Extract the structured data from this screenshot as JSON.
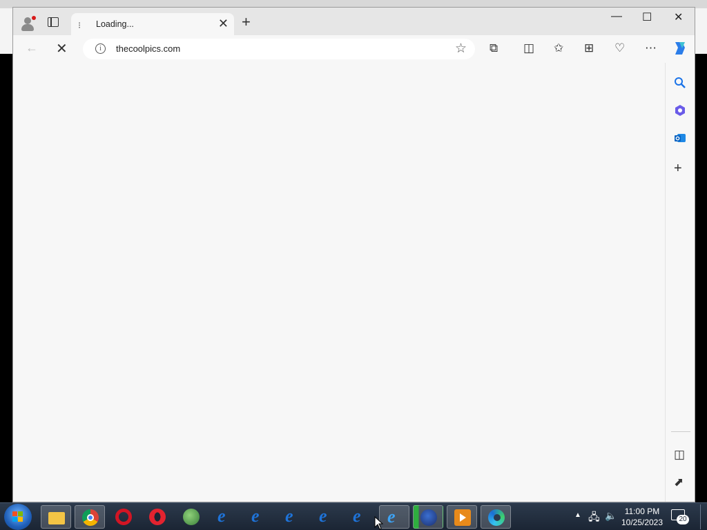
{
  "browser": {
    "tab": {
      "title": "Loading...",
      "close_glyph": "✕"
    },
    "new_tab_glyph": "+",
    "window_controls": {
      "minimize": "—",
      "maximize": "☐",
      "close": "✕"
    },
    "toolbar": {
      "back_glyph": "←",
      "stop_glyph": "✕",
      "info_glyph": "i",
      "star_glyph": "☆",
      "more_glyph": "⋯"
    },
    "address": {
      "url": "thecoolpics.com"
    },
    "toolbar_icons": [
      "extensions-icon",
      "split-screen-icon",
      "favorites-icon",
      "collections-icon",
      "browser-essentials-icon",
      "more-icon",
      "copilot-icon"
    ],
    "sidebar_icons": [
      "search-icon",
      "office-icon",
      "outlook-icon",
      "add-icon",
      "hide-sidebar-icon",
      "external-link-icon",
      "settings-icon"
    ],
    "sidebar_add_glyph": "+"
  },
  "taskbar": {
    "apps": [
      "file-explorer-icon",
      "chrome-icon",
      "opera-icon",
      "opera-icon",
      "network-globe-icon",
      "internet-explorer-icon",
      "internet-explorer-icon",
      "internet-explorer-icon",
      "internet-explorer-icon",
      "internet-explorer-icon",
      "internet-explorer-icon",
      "firefox-icon",
      "media-player-icon",
      "edge-icon"
    ],
    "tray": {
      "time": "11:00 PM",
      "date": "10/25/2023",
      "notification_count": "20"
    }
  }
}
